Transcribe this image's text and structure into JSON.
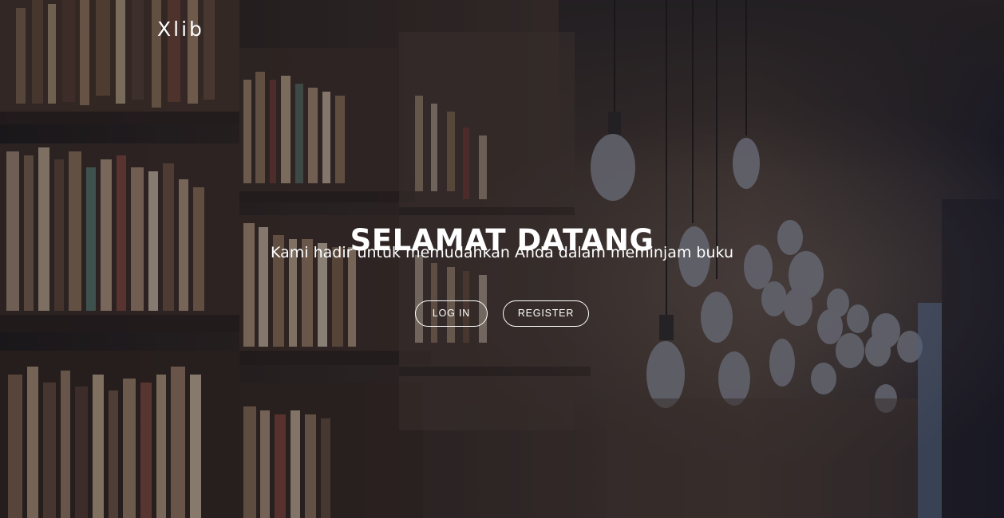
{
  "brand": {
    "name": "Xlib"
  },
  "hero": {
    "title": "SELAMAT DATANG",
    "subtitle": "Kami hadir untuk memudahkan Anda dalam meminjam buku"
  },
  "actions": {
    "login_label": "LOG IN",
    "register_label": "REGISTER"
  },
  "colors": {
    "text": "#ffffff",
    "overlay": "#141628",
    "background": "#2a211c"
  }
}
